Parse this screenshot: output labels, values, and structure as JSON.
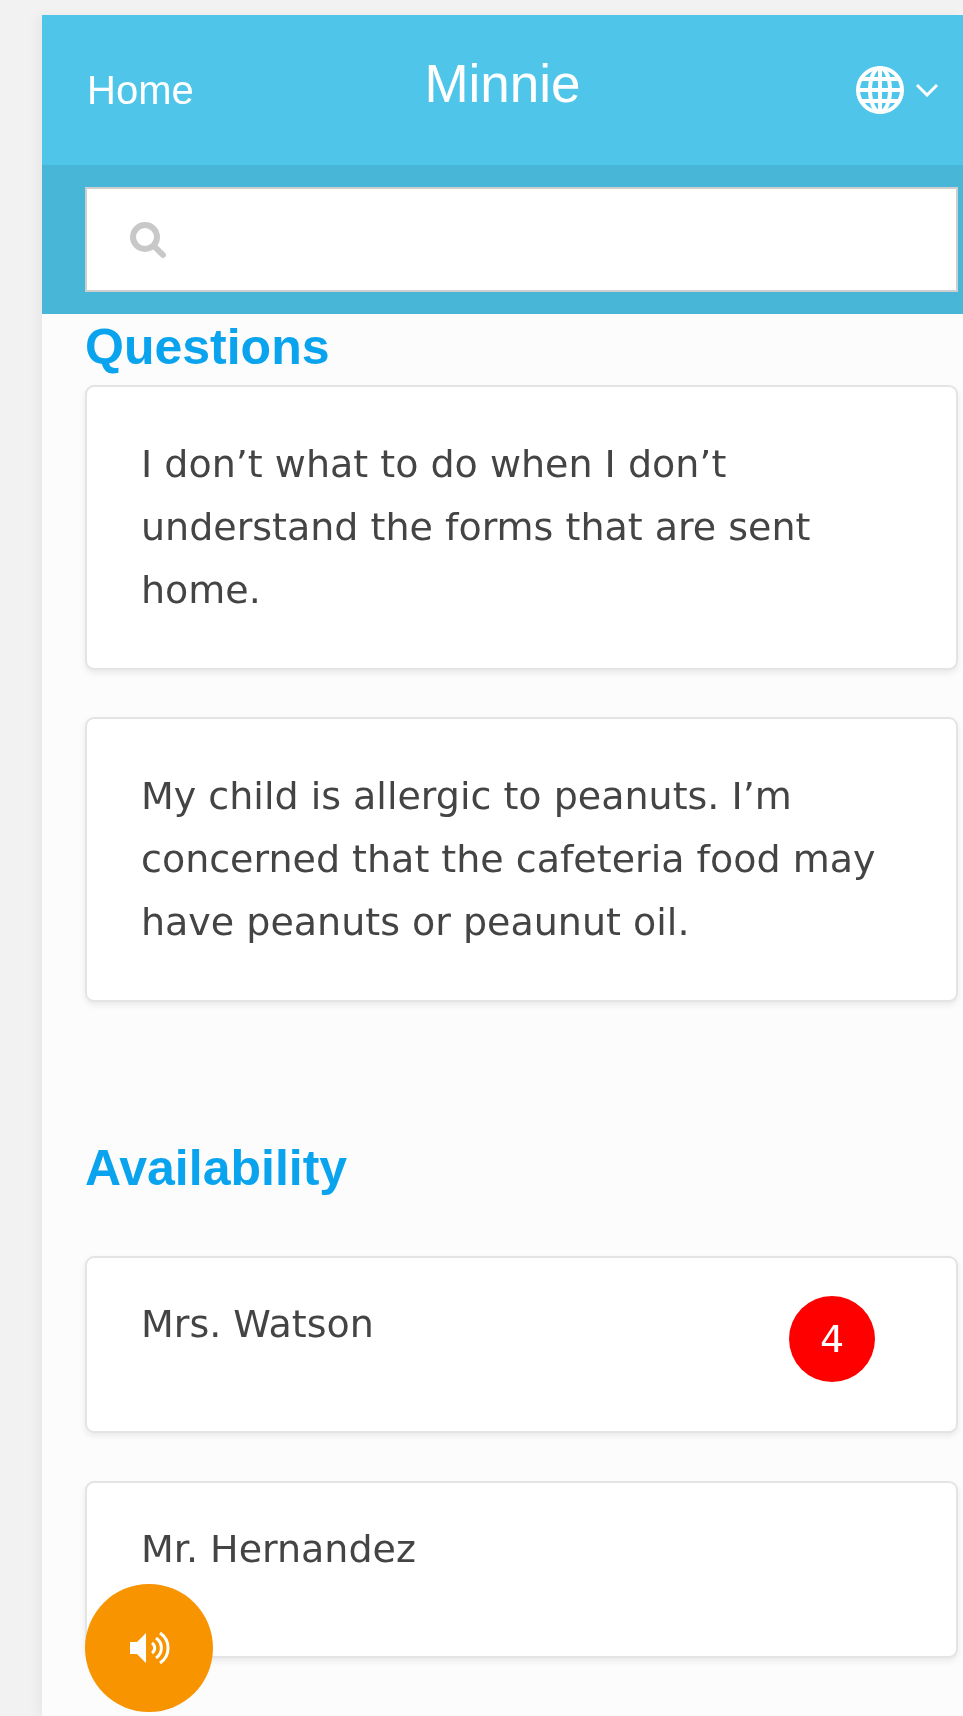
{
  "header": {
    "home_link": "Home",
    "title": "Minnie"
  },
  "questions": {
    "heading": "Questions",
    "items": [
      {
        "text": "I don’t what to do when I don’t understand the forms that are sent home."
      },
      {
        "text": "My child is allergic to peanuts. I’m concerned that the cafeteria food may have peanuts or peaunut oil."
      }
    ]
  },
  "availability": {
    "heading": "Availability",
    "items": [
      {
        "name": "Mrs. Watson",
        "badge": "4"
      },
      {
        "name": "Mr. Hernandez"
      }
    ]
  }
}
